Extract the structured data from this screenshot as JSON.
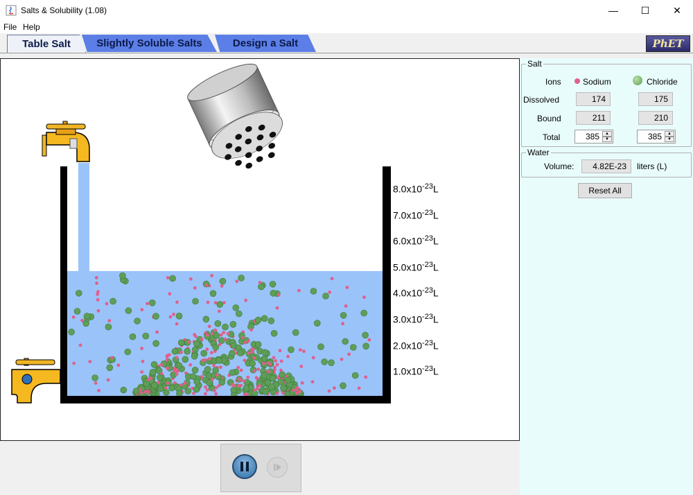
{
  "window": {
    "title": "Salts & Solubility (1.08)",
    "minimize": "—",
    "maximize": "☐",
    "close": "✕"
  },
  "menu": [
    "File",
    "Help"
  ],
  "tabs": [
    "Table Salt",
    "Slightly Soluble Salts",
    "Design a Salt"
  ],
  "logo_text": "PhET",
  "beaker_ticks": [
    {
      "mantissa": "8.0x10",
      "exp": "-23",
      "unit": "L"
    },
    {
      "mantissa": "7.0x10",
      "exp": "-23",
      "unit": "L"
    },
    {
      "mantissa": "6.0x10",
      "exp": "-23",
      "unit": "L"
    },
    {
      "mantissa": "5.0x10",
      "exp": "-23",
      "unit": "L"
    },
    {
      "mantissa": "4.0x10",
      "exp": "-23",
      "unit": "L"
    },
    {
      "mantissa": "3.0x10",
      "exp": "-23",
      "unit": "L"
    },
    {
      "mantissa": "2.0x10",
      "exp": "-23",
      "unit": "L"
    },
    {
      "mantissa": "1.0x10",
      "exp": "-23",
      "unit": "L"
    }
  ],
  "salt_panel": {
    "title": "Salt",
    "ions_label": "Ions",
    "sodium_label": "Sodium",
    "chloride_label": "Chloride",
    "sodium_color": "#e0608a",
    "chloride_color": "#5e9e58",
    "dissolved_label": "Dissolved",
    "bound_label": "Bound",
    "total_label": "Total",
    "sodium": {
      "dissolved": "174",
      "bound": "211",
      "total": "385"
    },
    "chloride": {
      "dissolved": "175",
      "bound": "210",
      "total": "385"
    }
  },
  "water_panel": {
    "title": "Water",
    "volume_label": "Volume:",
    "volume_value": "4.82E-23",
    "unit": "liters (L)"
  },
  "reset_label": "Reset All",
  "water_color": "#9ac3fa"
}
